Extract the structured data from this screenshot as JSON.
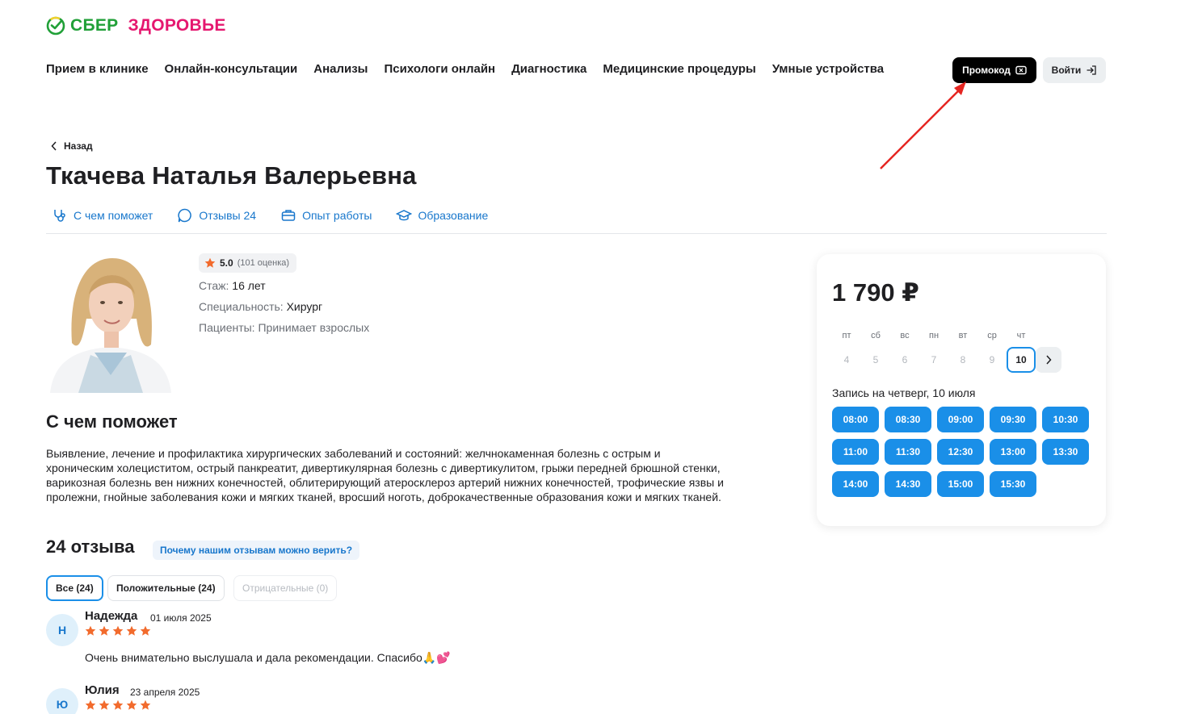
{
  "header": {
    "logo_sber": "СБЕР",
    "logo_health": "ЗДОРОВЬЕ",
    "nav": [
      "Прием в клинике",
      "Онлайн-консультации",
      "Анализы",
      "Психологи онлайн",
      "Диагностика",
      "Медицинские процедуры",
      "Умные устройства"
    ],
    "promo_label": "Промокод",
    "login_label": "Войти"
  },
  "doctor": {
    "back_label": "Назад",
    "name": "Ткачева Наталья Валерьевна",
    "tabs": [
      "С чем поможет",
      "Отзывы 24",
      "Опыт работы",
      "Образование"
    ],
    "rating_value": "5.0",
    "rating_count": "(101 оценка)",
    "experience_label": "Стаж:",
    "experience_value": "16 лет",
    "specialty_label": "Специальность:",
    "specialty_value": "Хирург",
    "patients_label": "Пациенты:",
    "patients_value": "Принимает взрослых"
  },
  "help": {
    "title": "С чем поможет",
    "text": "Выявление, лечение и профилактика хирургических заболеваний и состояний: желчнокаменная болезнь с острым и хроническим холециститом, острый панкреатит, дивертикулярная болезнь с дивертикулитом, грыжи передней брюшной стенки, варикозная болезнь вен нижних конечностей, облитерирующий атеросклероз артерий нижних конечностей, трофические язвы и пролежни, гнойные заболевания кожи и мягких тканей, вросший ноготь, доброкачественные образования кожи и мягких тканей."
  },
  "reviews": {
    "title": "24 отзыва",
    "trust_link": "Почему нашим отзывам можно верить?",
    "filters": [
      "Все (24)",
      "Положительные (24)",
      "Отрицательные (0)"
    ],
    "items": [
      {
        "initial": "Н",
        "name": "Надежда",
        "date": "01 июля 2025",
        "stars": 5,
        "text": "Очень внимательно выслушала и дала рекомендации. Спасибо🙏💕"
      },
      {
        "initial": "Ю",
        "name": "Юлия",
        "date": "23 апреля 2025",
        "stars": 5,
        "text": ""
      }
    ]
  },
  "booking": {
    "price": "1 790 ₽",
    "weekdays": [
      "пт",
      "сб",
      "вс",
      "пн",
      "вт",
      "ср",
      "чт"
    ],
    "days": [
      "4",
      "5",
      "6",
      "7",
      "8",
      "9",
      "10"
    ],
    "selected_day": "10",
    "slot_title": "Запись на четверг, 10 июля",
    "slots": [
      "08:00",
      "08:30",
      "09:00",
      "09:30",
      "10:30",
      "11:00",
      "11:30",
      "12:30",
      "13:00",
      "13:30",
      "14:00",
      "14:30",
      "15:00",
      "15:30"
    ]
  },
  "colors": {
    "accent_blue": "#1a8fe8",
    "link_blue": "#1877cc",
    "sber_green": "#21a038",
    "health_pink": "#e5176f",
    "star_orange": "#f26b2d",
    "annotation_red": "#e52521"
  }
}
